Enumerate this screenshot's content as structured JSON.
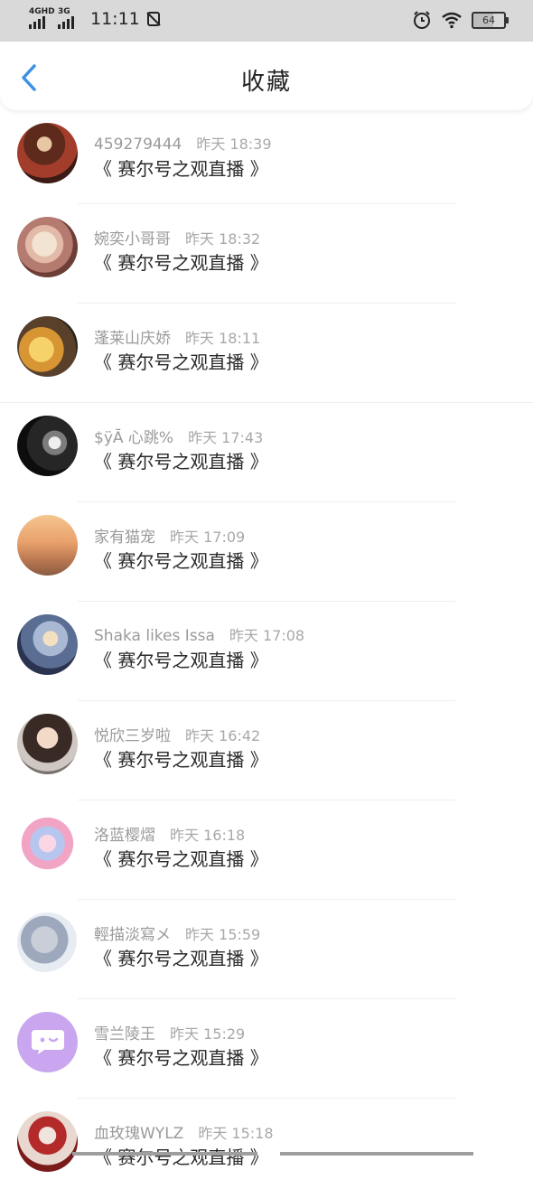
{
  "status_bar": {
    "network1": "4GHD",
    "network2": "3G",
    "time": "11:11",
    "battery": "64",
    "icons": [
      "signal-icon",
      "sim-off-icon",
      "alarm-icon",
      "wifi-icon",
      "battery-icon"
    ]
  },
  "header": {
    "title": "收藏",
    "back_icon": "back-arrow-icon",
    "accent": "#3d8fe8"
  },
  "favorites": [
    {
      "name": "459279444",
      "time": "昨天 18:39",
      "message": "《 赛尔号之观直播 》"
    },
    {
      "name": "婉奕小哥哥",
      "time": "昨天 18:32",
      "message": "《 赛尔号之观直播 》"
    },
    {
      "name": "蓬莱山庆娇",
      "time": "昨天 18:11",
      "message": "《 赛尔号之观直播 》"
    },
    {
      "name": "$ÿĀ 心跳%",
      "time": "昨天 17:43",
      "message": "《 赛尔号之观直播 》"
    },
    {
      "name": "家有猫宠",
      "time": "昨天 17:09",
      "message": "《 赛尔号之观直播 》"
    },
    {
      "name": "Shaka likes Issa",
      "time": "昨天 17:08",
      "message": "《 赛尔号之观直播 》"
    },
    {
      "name": "悦欣三岁啦",
      "time": "昨天 16:42",
      "message": "《 赛尔号之观直播 》"
    },
    {
      "name": "洛蓝樱熠",
      "time": "昨天 16:18",
      "message": "《 赛尔号之观直播 》"
    },
    {
      "name": " 輕描淡寫メ",
      "time": "昨天 15:59",
      "message": "《 赛尔号之观直播 》"
    },
    {
      "name": "雪兰陵王",
      "time": "昨天 15:29",
      "message": "《 赛尔号之观直播 》"
    },
    {
      "name": "血玫瑰WYLZ",
      "time": "昨天 15:18",
      "message": "《 赛尔号之观直播 》"
    }
  ]
}
